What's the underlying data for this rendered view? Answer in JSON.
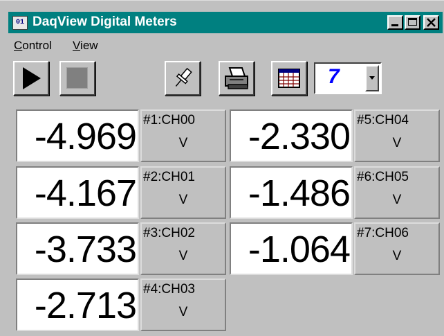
{
  "window": {
    "title": "DaqView Digital Meters",
    "icon_text": "01",
    "controls": [
      "minimize-icon",
      "maximize-icon",
      "close-icon"
    ]
  },
  "menu": [
    {
      "label_underlined": "C",
      "label_rest": "ontrol"
    },
    {
      "label_underlined": "V",
      "label_rest": "iew"
    }
  ],
  "toolbar": {
    "buttons": [
      "play-icon",
      "stop-icon",
      "pin-icon",
      "print-icon",
      "grid-icon"
    ],
    "combo_value": "7"
  },
  "meters": [
    {
      "value": "-4.969",
      "channel": "#1:CH00",
      "unit": "V"
    },
    {
      "value": "-4.167",
      "channel": "#2:CH01",
      "unit": "V"
    },
    {
      "value": "-3.733",
      "channel": "#3:CH02",
      "unit": "V"
    },
    {
      "value": "-2.713",
      "channel": "#4:CH03",
      "unit": "V"
    },
    {
      "value": "-2.330",
      "channel": "#5:CH04",
      "unit": "V"
    },
    {
      "value": "-1.486",
      "channel": "#6:CH05",
      "unit": "V"
    },
    {
      "value": "-1.064",
      "channel": "#7:CH06",
      "unit": "V"
    }
  ],
  "colors": {
    "titlebar": "#008080",
    "face": "#c0c0c0",
    "combo_text": "#0000ff"
  }
}
